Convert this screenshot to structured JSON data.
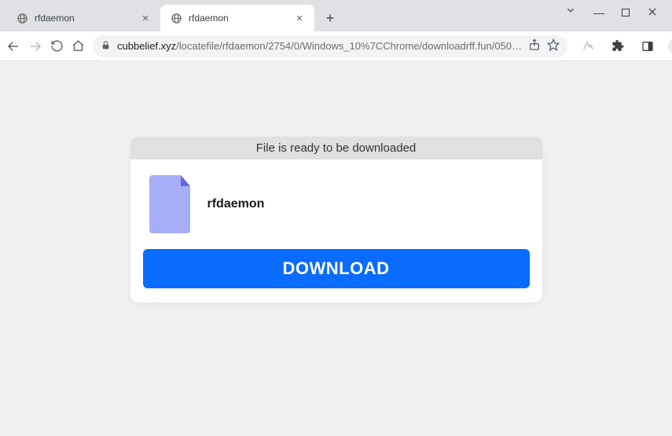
{
  "window_controls": {
    "minimize_glyph": "—",
    "close_label": "Close"
  },
  "tabs": [
    {
      "title": "rfdaemon",
      "active": false
    },
    {
      "title": "rfdaemon",
      "active": true
    }
  ],
  "omnibox": {
    "host": "cubbelief.xyz",
    "path": "/locatefile/rfdaemon/2754/0/Windows_10%7CChrome/downloadrff.fun/050…"
  },
  "page": {
    "header": "File is ready to be downloaded",
    "filename": "rfdaemon",
    "download_label": "DOWNLOAD"
  },
  "colors": {
    "primary": "#0a6cff",
    "file_icon_light": "#a7aef8",
    "file_icon_dark": "#5f68e6"
  }
}
